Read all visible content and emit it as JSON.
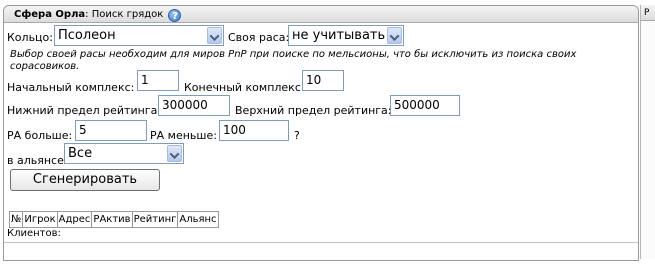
{
  "header": {
    "title_bold": "Сфера Орла",
    "title_rest": "Поиск грядок",
    "help_icon": "help-icon"
  },
  "form": {
    "ring_label": "Кольцо:",
    "ring_value": "Псолеон",
    "race_label": "Своя раса:",
    "race_value": "не учитывать",
    "note": "Выбор своей расы необходим для миров PnP при поиске по мельсионы, что бы исключить из поиска своих сорасовиков.",
    "start_label": "Начальный комплекс:",
    "start_value": "1",
    "end_label": "Конечный комплекс:",
    "end_value": "10",
    "low_rating_label": "Нижний предел рейтинга:",
    "low_rating_value": "300000",
    "high_rating_label": "Верхний предел рейтинга:",
    "high_rating_value": "500000",
    "ra_more_label": "РА больше:",
    "ra_more_value": "5",
    "ra_less_label": "РА меньше:",
    "ra_less_value": "100",
    "question_mark": "?",
    "alliance_label": "в альянсе",
    "alliance_value": "Все",
    "generate_button": "Сгенерировать"
  },
  "table": {
    "columns": [
      "№",
      "Игрок",
      "Адрес",
      "РАктив",
      "Рейтинг",
      "Альянс"
    ]
  },
  "footer": {
    "clients_label": "Клиентов:"
  },
  "right_panel": {
    "header_text": "Р"
  }
}
